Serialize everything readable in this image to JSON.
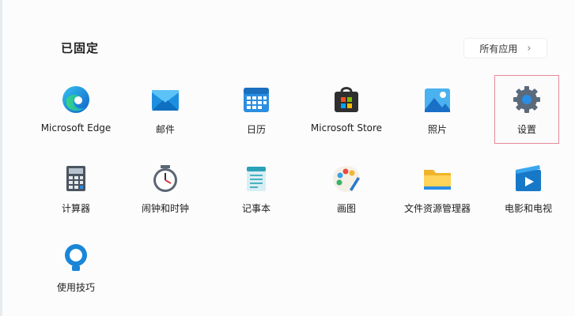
{
  "start_menu": {
    "pinned_title": "已固定",
    "all_apps_label": "所有应用",
    "pinned_apps": [
      {
        "label": "Microsoft Edge",
        "icon": "edge-icon"
      },
      {
        "label": "邮件",
        "icon": "mail-icon"
      },
      {
        "label": "日历",
        "icon": "calendar-icon"
      },
      {
        "label": "Microsoft Store",
        "icon": "store-icon"
      },
      {
        "label": "照片",
        "icon": "photos-icon"
      },
      {
        "label": "设置",
        "icon": "gear-icon",
        "highlighted": true
      },
      {
        "label": "计算器",
        "icon": "calculator-icon"
      },
      {
        "label": "闹钟和时钟",
        "icon": "alarm-clock-icon"
      },
      {
        "label": "记事本",
        "icon": "notepad-icon"
      },
      {
        "label": "画图",
        "icon": "paint-palette-icon"
      },
      {
        "label": "文件资源管理器",
        "icon": "folder-icon"
      },
      {
        "label": "电影和电视",
        "icon": "movies-icon"
      },
      {
        "label": "使用技巧",
        "icon": "tips-bulb-icon"
      }
    ]
  },
  "colors": {
    "highlight_border": "#e4899a",
    "accent_blue": "#1a8fd8"
  }
}
